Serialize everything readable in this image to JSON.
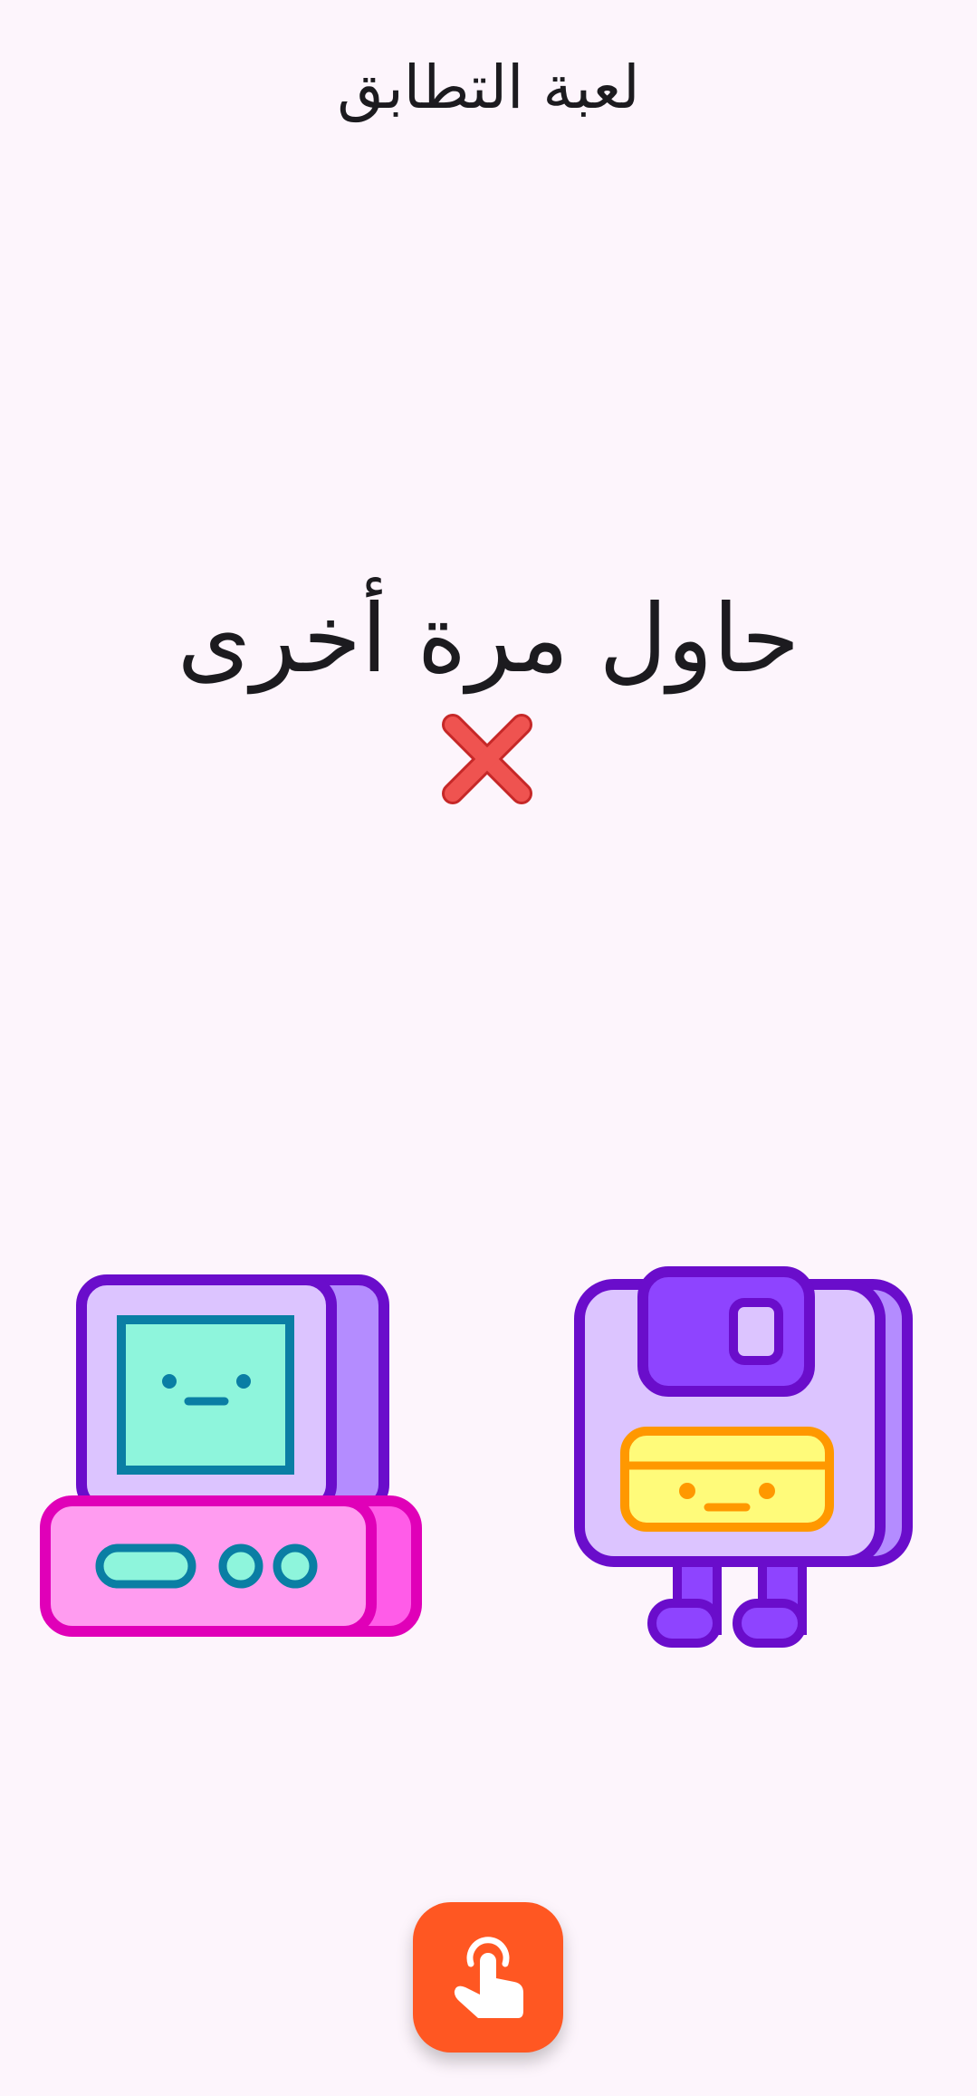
{
  "header": {
    "title": "لعبة التطابق"
  },
  "result": {
    "message": "حاول مرة أخرى",
    "icon": "cross-mark-icon",
    "icon_color": "#e53935"
  },
  "cards": [
    {
      "icon": "retro-computer-icon"
    },
    {
      "icon": "floppy-disk-character-icon"
    }
  ],
  "action": {
    "icon": "tap-finger-icon",
    "color": "#ff5722"
  }
}
